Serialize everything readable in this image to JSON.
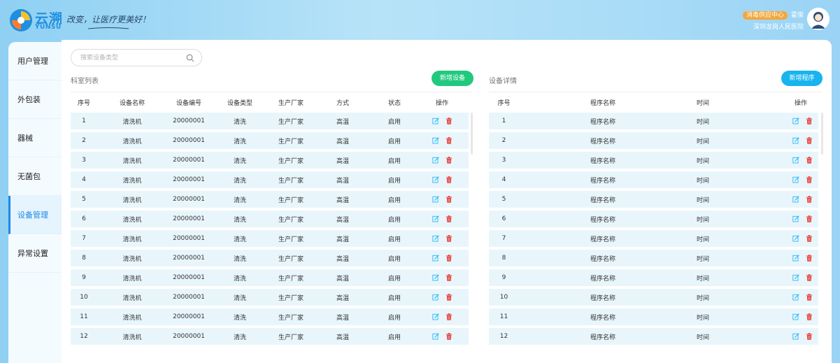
{
  "header": {
    "brand_cn": "云溯",
    "brand_en": "YUNSU",
    "slogan": "改变，让医疗更美好！",
    "department": "消毒供应中心",
    "user": "霍俊",
    "hospital": "深圳龙岗人民医院",
    "colors": {
      "brand": "#1e8fe0",
      "badge": "#f3a63a"
    }
  },
  "sidebar": {
    "items": [
      {
        "label": "用户管理",
        "active": false
      },
      {
        "label": "外包装",
        "active": false
      },
      {
        "label": "器械",
        "active": false
      },
      {
        "label": "无菌包",
        "active": false
      },
      {
        "label": "设备管理",
        "active": true
      },
      {
        "label": "异常设置",
        "active": false
      }
    ]
  },
  "search": {
    "placeholder": "搜索设备类型",
    "icon": "search-icon"
  },
  "left_panel": {
    "title": "科室列表",
    "add_button": "新增设备",
    "columns": [
      "序号",
      "设备名称",
      "设备编号",
      "设备类型",
      "生产厂家",
      "方式",
      "状态",
      "操作"
    ],
    "rows": [
      [
        "1",
        "清洗机",
        "20000001",
        "清洗",
        "生产厂家",
        "高温",
        "启用"
      ],
      [
        "2",
        "清洗机",
        "20000001",
        "清洗",
        "生产厂家",
        "高温",
        "启用"
      ],
      [
        "3",
        "清洗机",
        "20000001",
        "清洗",
        "生产厂家",
        "高温",
        "启用"
      ],
      [
        "4",
        "清洗机",
        "20000001",
        "清洗",
        "生产厂家",
        "高温",
        "启用"
      ],
      [
        "5",
        "清洗机",
        "20000001",
        "清洗",
        "生产厂家",
        "高温",
        "启用"
      ],
      [
        "6",
        "清洗机",
        "20000001",
        "清洗",
        "生产厂家",
        "高温",
        "启用"
      ],
      [
        "7",
        "清洗机",
        "20000001",
        "清洗",
        "生产厂家",
        "高温",
        "启用"
      ],
      [
        "8",
        "清洗机",
        "20000001",
        "清洗",
        "生产厂家",
        "高温",
        "启用"
      ],
      [
        "9",
        "清洗机",
        "20000001",
        "清洗",
        "生产厂家",
        "高温",
        "启用"
      ],
      [
        "10",
        "清洗机",
        "20000001",
        "清洗",
        "生产厂家",
        "高温",
        "启用"
      ],
      [
        "11",
        "清洗机",
        "20000001",
        "清洗",
        "生产厂家",
        "高温",
        "启用"
      ],
      [
        "12",
        "清洗机",
        "20000001",
        "清洗",
        "生产厂家",
        "高温",
        "启用"
      ]
    ]
  },
  "right_panel": {
    "title": "设备详情",
    "add_button": "新增程序",
    "columns": [
      "序号",
      "程序名称",
      "时间",
      "操作"
    ],
    "rows": [
      [
        "1",
        "程序名称",
        "时间"
      ],
      [
        "2",
        "程序名称",
        "时间"
      ],
      [
        "3",
        "程序名称",
        "时间"
      ],
      [
        "4",
        "程序名称",
        "时间"
      ],
      [
        "5",
        "程序名称",
        "时间"
      ],
      [
        "6",
        "程序名称",
        "时间"
      ],
      [
        "7",
        "程序名称",
        "时间"
      ],
      [
        "8",
        "程序名称",
        "时间"
      ],
      [
        "9",
        "程序名称",
        "时间"
      ],
      [
        "10",
        "程序名称",
        "时间"
      ],
      [
        "11",
        "程序名称",
        "时间"
      ],
      [
        "12",
        "程序名称",
        "时间"
      ]
    ]
  },
  "icons": {
    "edit": "edit-icon",
    "delete": "delete-icon"
  },
  "colors": {
    "accent": "#1e88e5",
    "green": "#21c97e",
    "blue": "#18b4f0",
    "row_bg": "#e8f6fc",
    "edit": "#29b6f6",
    "delete": "#e53935"
  }
}
